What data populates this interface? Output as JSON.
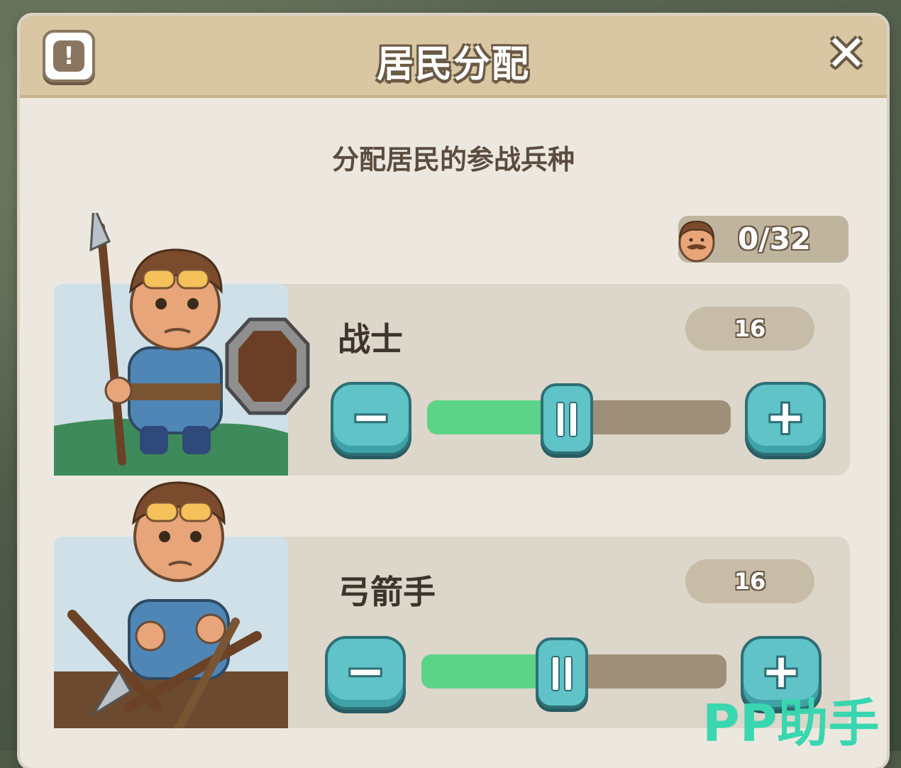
{
  "dialog": {
    "title": "居民分配",
    "info_icon": "exclamation-icon",
    "info_symbol": "!",
    "close_icon": "close-icon",
    "close_symbol": "✕",
    "subtitle": "分配居民的参战兵种"
  },
  "population": {
    "icon": "villager-face-icon",
    "value": "0/32"
  },
  "units": [
    {
      "name": "战士",
      "count": "16",
      "slider_fraction": 0.45,
      "portrait": "spearman-shield-portrait",
      "minus_symbol": "−",
      "plus_symbol": "+"
    },
    {
      "name": "弓箭手",
      "count": "16",
      "slider_fraction": 0.45,
      "portrait": "archer-arrows-portrait",
      "minus_symbol": "−",
      "plus_symbol": "+"
    }
  ],
  "watermark": "PP助手",
  "colors": {
    "panel": "#ede8df",
    "header": "#d9c7a3",
    "button_teal": "#5fc3c7",
    "slider_fill": "#5bd488",
    "slider_track": "#9e9078"
  }
}
